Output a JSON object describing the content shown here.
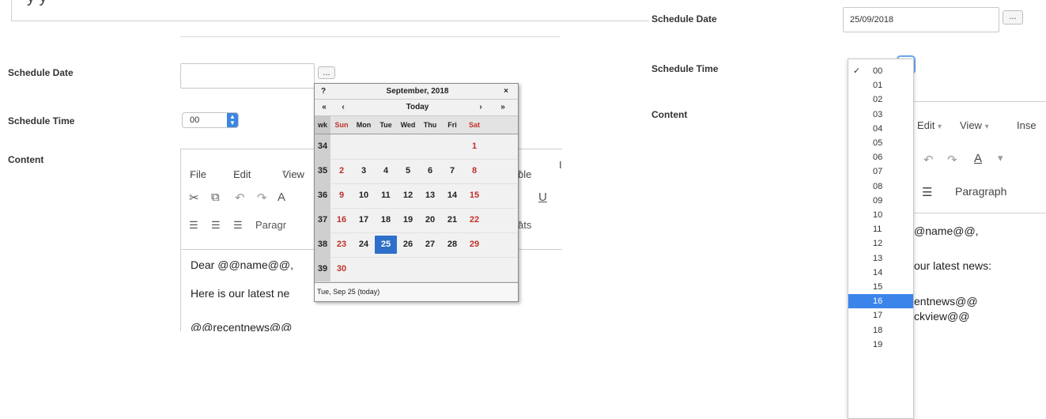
{
  "left": {
    "header_fragment": "y              y",
    "schedule_date_label": "Schedule Date",
    "schedule_date_value": "",
    "date_button": "...",
    "schedule_time_label": "Schedule Time",
    "schedule_time_value": "00",
    "content_label": "Content",
    "menu": {
      "file": "File",
      "edit": "Edit",
      "view": "View",
      "table": "ble",
      "more": "I"
    },
    "toolbar": {
      "paragraph": "Paragr",
      "formats": "ats"
    },
    "body_lines": [
      "Dear @@name@@,",
      "Here is our latest ne",
      "@@recentnews@@"
    ]
  },
  "calendar": {
    "help": "?",
    "month_title": "September, 2018",
    "close": "×",
    "prev_year": "«",
    "prev_month": "‹",
    "today": "Today",
    "next_month": "›",
    "next_year": "»",
    "weekday_headers": [
      "wk",
      "Sun",
      "Mon",
      "Tue",
      "Wed",
      "Thu",
      "Fri",
      "Sat"
    ],
    "weeks": [
      {
        "wk": "34",
        "days": [
          "",
          "",
          "",
          "",
          "",
          "",
          "1"
        ]
      },
      {
        "wk": "35",
        "days": [
          "2",
          "3",
          "4",
          "5",
          "6",
          "7",
          "8"
        ]
      },
      {
        "wk": "36",
        "days": [
          "9",
          "10",
          "11",
          "12",
          "13",
          "14",
          "15"
        ]
      },
      {
        "wk": "37",
        "days": [
          "16",
          "17",
          "18",
          "19",
          "20",
          "21",
          "22"
        ]
      },
      {
        "wk": "38",
        "days": [
          "23",
          "24",
          "25",
          "26",
          "27",
          "28",
          "29"
        ]
      },
      {
        "wk": "39",
        "days": [
          "30",
          "",
          "",
          "",
          "",
          "",
          ""
        ]
      }
    ],
    "selected_day": "25",
    "footer": "Tue, Sep 25 (today)"
  },
  "right": {
    "schedule_date_label": "Schedule Date",
    "schedule_date_value": "25/09/2018",
    "date_button": "...",
    "schedule_time_label": "Schedule Time",
    "content_label": "Content",
    "menu": {
      "edit": "Edit",
      "view": "View",
      "insert": "Inse"
    },
    "toolbar": {
      "paragraph": "Paragraph"
    },
    "body_lines": [
      "@name@@,",
      "our latest news:",
      "entnews@@",
      "ckview@@"
    ],
    "time_options": [
      "00",
      "01",
      "02",
      "03",
      "04",
      "05",
      "06",
      "07",
      "08",
      "09",
      "10",
      "11",
      "12",
      "13",
      "14",
      "15",
      "16",
      "17",
      "18",
      "19"
    ],
    "checked_option": "00",
    "highlighted_option": "16",
    "check_mark": "✓"
  },
  "colors": {
    "accent": "#3b84ea",
    "weekend_red": "#c0322b",
    "selected_day": "#2e6fc9"
  }
}
